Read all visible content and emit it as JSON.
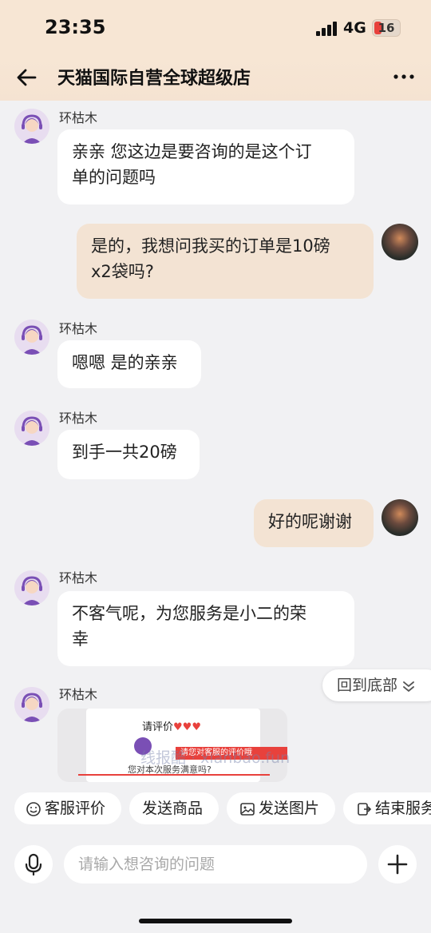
{
  "status_bar": {
    "time": "23:35",
    "network": "4G",
    "battery": "16"
  },
  "header": {
    "title": "天猫国际自营全球超级店"
  },
  "messages": [
    {
      "sender": "环枯木",
      "text": "亲亲 您这边是要咨询的是这个订\n单的问题吗"
    },
    {
      "sender": "",
      "text": "是的，我想问我买的订单是10磅\nx2袋吗?"
    },
    {
      "sender": "环枯木",
      "text": "嗯嗯 是的亲亲"
    },
    {
      "sender": "环枯木",
      "text": "到手一共20磅"
    },
    {
      "sender": "",
      "text": "好的呢谢谢"
    },
    {
      "sender": "环枯木",
      "text": "不客气呢，为您服务是小二的荣\n幸"
    },
    {
      "sender": "环枯木"
    }
  ],
  "rating_card": {
    "title": "请评价",
    "hearts": "♥♥♥",
    "banner": "请您对客服的评价哦",
    "question": "您对本次服务满意吗?"
  },
  "watermark": "线报酷 · xianbao.fun",
  "jump_bottom": "回到底部",
  "quick_actions": [
    {
      "label": "客服评价",
      "icon": "smile-icon"
    },
    {
      "label": "发送商品",
      "icon": ""
    },
    {
      "label": "发送图片",
      "icon": "image-icon"
    },
    {
      "label": "结束服务",
      "icon": "exit-icon"
    }
  ],
  "input": {
    "placeholder": "请输入想咨询的问题"
  },
  "colors": {
    "header_bg": "#f7e6d4",
    "outgoing_bubble": "#f3e3d3",
    "incoming_bubble": "#ffffff",
    "accent": "#e8413c"
  }
}
